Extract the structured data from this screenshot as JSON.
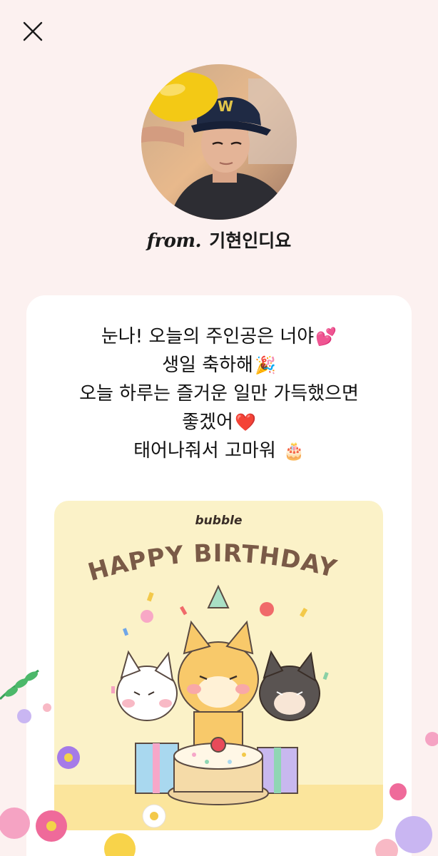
{
  "sender": {
    "prefix": "from.",
    "name": "기현인디요"
  },
  "message": {
    "lines": [
      {
        "text": "눈나! 오늘의 주인공은 너야",
        "emoji": "💕"
      },
      {
        "text": "생일 축하해",
        "emoji": "🎉"
      },
      {
        "text": "오늘 하루는 즐거운 일만 가득했으면",
        "emoji": ""
      },
      {
        "text": "좋겠어",
        "emoji": "❤️"
      },
      {
        "text": "태어나줘서 고마워 ",
        "emoji": "🎂"
      }
    ]
  },
  "card_image": {
    "brand": "bubble",
    "headline": "HAPPY BIRTHDAY!"
  },
  "colors": {
    "page_background": "#fcf1f0",
    "card_background": "#ffffff",
    "birthday_card_background": "#fbf2c8",
    "headline_brown": "#7a5a47"
  },
  "icons": {
    "close": "close-icon"
  }
}
